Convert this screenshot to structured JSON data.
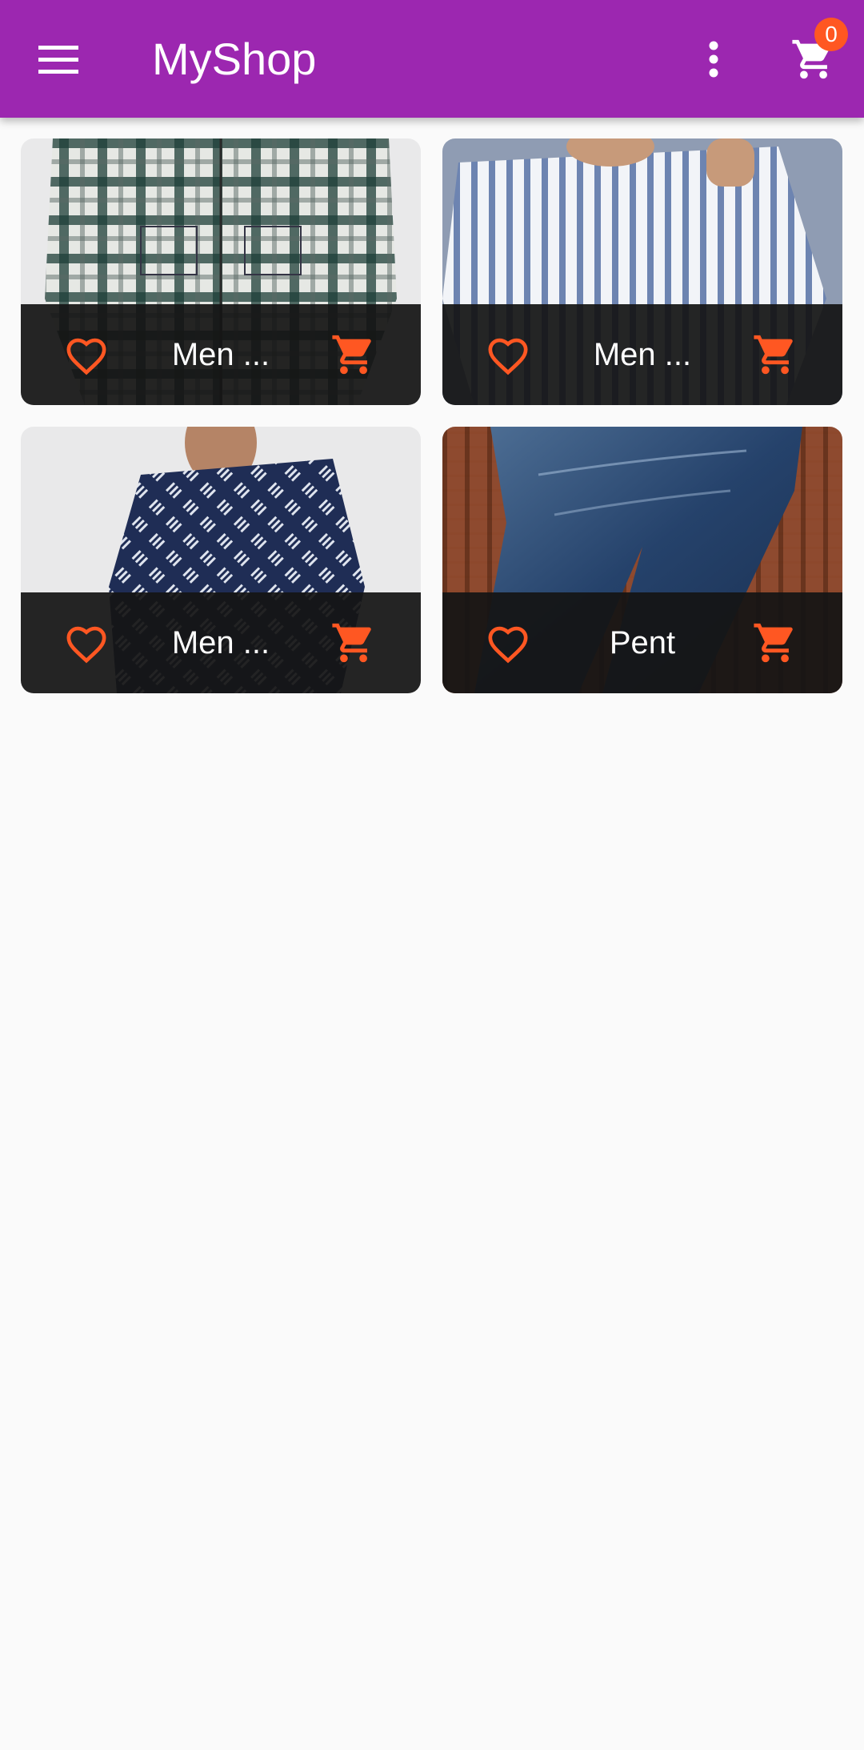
{
  "appbar": {
    "title": "MyShop",
    "cart_count": "0",
    "color": "#9c27b0",
    "icons": {
      "menu": "hamburger-menu-icon",
      "more": "more-vert-icon",
      "cart": "shopping-cart-icon"
    }
  },
  "products": [
    {
      "name": "Men ...",
      "image": "plaid-shirt",
      "favorite_icon": "heart-outline-icon",
      "cart_icon": "cart-icon"
    },
    {
      "name": "Men ...",
      "image": "striped-shirt",
      "favorite_icon": "heart-outline-icon",
      "cart_icon": "cart-icon"
    },
    {
      "name": "Men ...",
      "image": "navy-printed-shirt",
      "favorite_icon": "heart-outline-icon",
      "cart_icon": "cart-icon"
    },
    {
      "name": "Pent",
      "image": "denim-jeans",
      "favorite_icon": "heart-outline-icon",
      "cart_icon": "cart-icon"
    }
  ],
  "colors": {
    "accent": "#ff5722",
    "tile_footer": "#141414",
    "background": "#fafafa"
  }
}
